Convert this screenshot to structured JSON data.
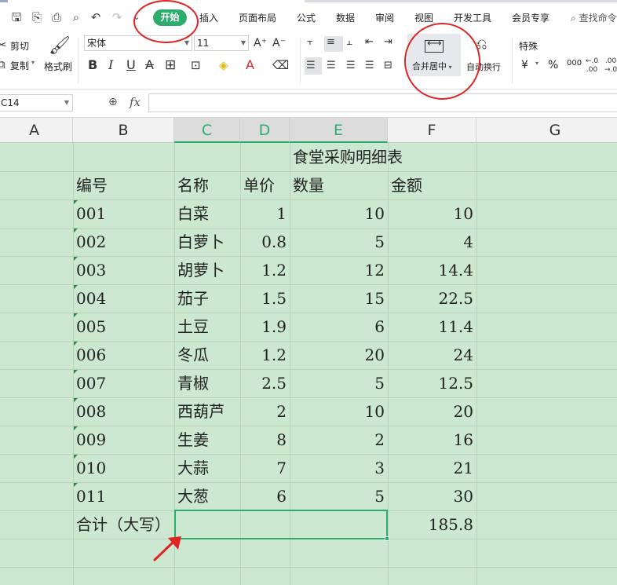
{
  "menu": {
    "tabs": [
      "开始",
      "插入",
      "页面布局",
      "公式",
      "数据",
      "审阅",
      "视图",
      "开发工具",
      "会员专享"
    ],
    "search": "查找命令"
  },
  "ribbon": {
    "cut": "剪切",
    "copy": "复制",
    "format_painter": "格式刷",
    "font_name": "宋体",
    "font_size": "11",
    "merge_center": "合并居中",
    "wrap_text": "自动换行",
    "number_format": "特殊",
    "currency_symbol": "¥",
    "percent_symbol": "%",
    "thousands_symbol": "000"
  },
  "formula_bar": {
    "cell_ref": "C14",
    "fx": "fx",
    "value": ""
  },
  "sheet": {
    "columns": [
      "A",
      "B",
      "C",
      "D",
      "E",
      "F",
      "G"
    ],
    "selected_columns": [
      "C",
      "D",
      "E"
    ],
    "title": "食堂采购明细表",
    "headers": [
      "编号",
      "名称",
      "单价",
      "数量",
      "金额"
    ],
    "rows": [
      [
        "001",
        "白菜",
        "1",
        "10",
        "10"
      ],
      [
        "002",
        "白萝卜",
        "0.8",
        "5",
        "4"
      ],
      [
        "003",
        "胡萝卜",
        "1.2",
        "12",
        "14.4"
      ],
      [
        "004",
        "茄子",
        "1.5",
        "15",
        "22.5"
      ],
      [
        "005",
        "土豆",
        "1.9",
        "6",
        "11.4"
      ],
      [
        "006",
        "冬瓜",
        "1.2",
        "20",
        "24"
      ],
      [
        "007",
        "青椒",
        "2.5",
        "5",
        "12.5"
      ],
      [
        "008",
        "西葫芦",
        "2",
        "10",
        "20"
      ],
      [
        "009",
        "生姜",
        "8",
        "2",
        "16"
      ],
      [
        "010",
        "大蒜",
        "7",
        "3",
        "21"
      ],
      [
        "011",
        "大葱",
        "6",
        "5",
        "30"
      ]
    ],
    "total_label": "合计（大写）",
    "total_value": "185.8"
  },
  "colors": {
    "accent": "#2dad6b",
    "sheet_bg": "#cde8d0",
    "annotation": "#e02424"
  }
}
